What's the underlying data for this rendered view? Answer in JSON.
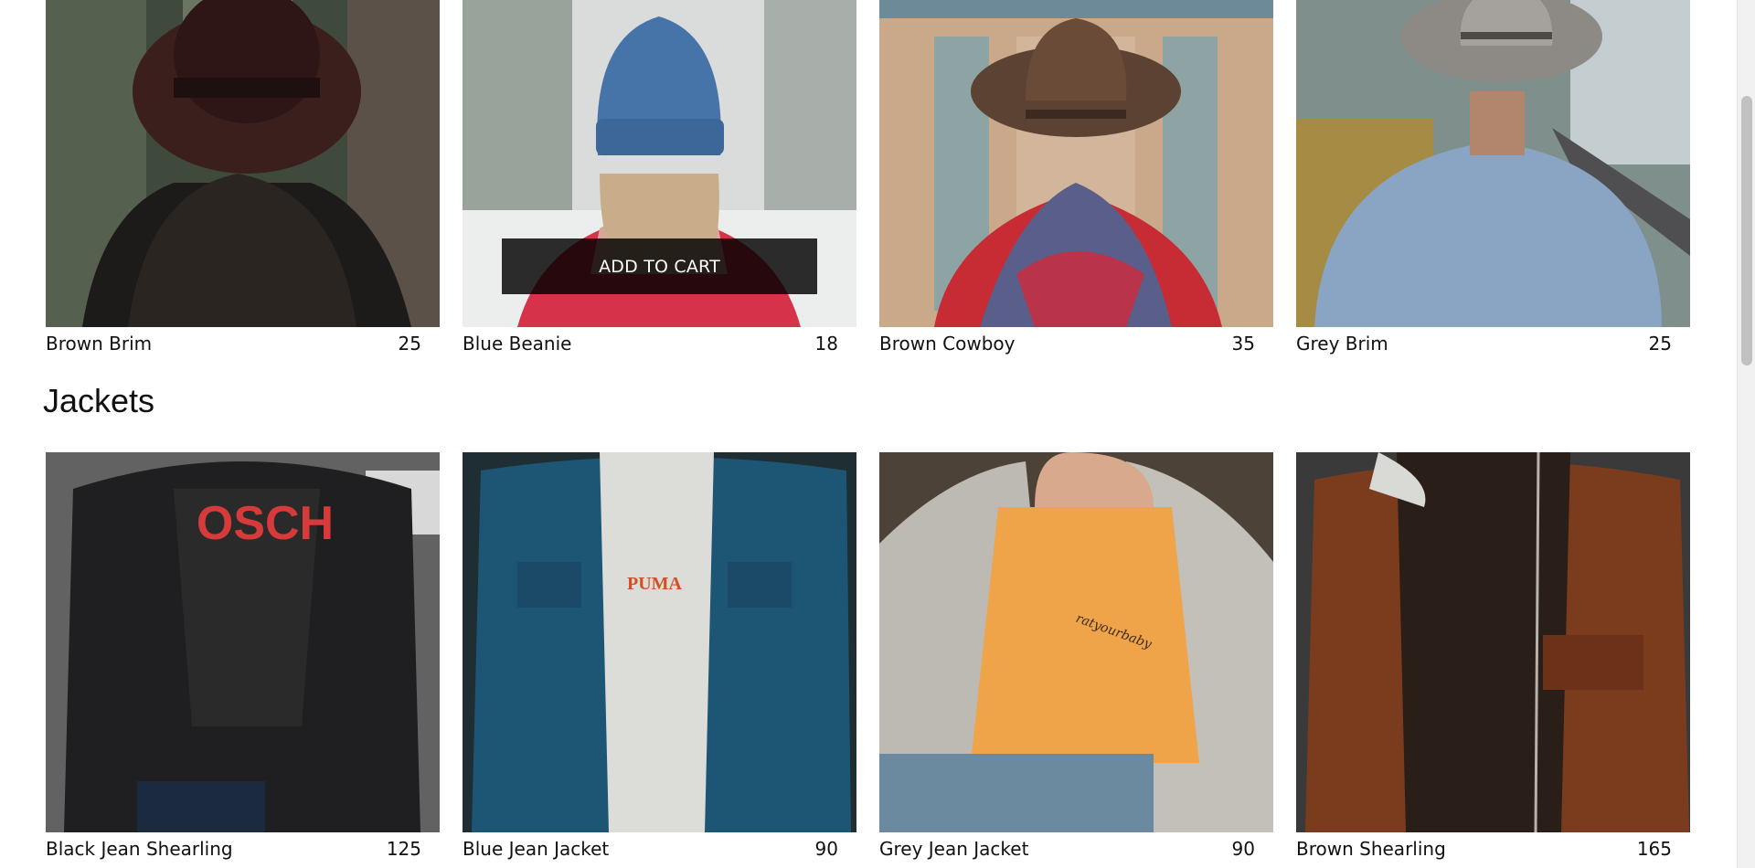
{
  "hats": {
    "items": [
      {
        "name": "Brown Brim",
        "price": "25"
      },
      {
        "name": "Blue Beanie",
        "price": "18",
        "button": "ADD TO CART"
      },
      {
        "name": "Brown Cowboy",
        "price": "35"
      },
      {
        "name": "Grey Brim",
        "price": "25"
      }
    ]
  },
  "jackets": {
    "title": "Jackets",
    "items": [
      {
        "name": "Black Jean Shearling",
        "price": "125",
        "shirt_text": "OSCH"
      },
      {
        "name": "Blue Jean Jacket",
        "price": "90",
        "shirt_text": "PUMA"
      },
      {
        "name": "Grey Jean Jacket",
        "price": "90",
        "shirt_text": "ratyourbaby"
      },
      {
        "name": "Brown Shearling",
        "price": "165"
      }
    ]
  }
}
